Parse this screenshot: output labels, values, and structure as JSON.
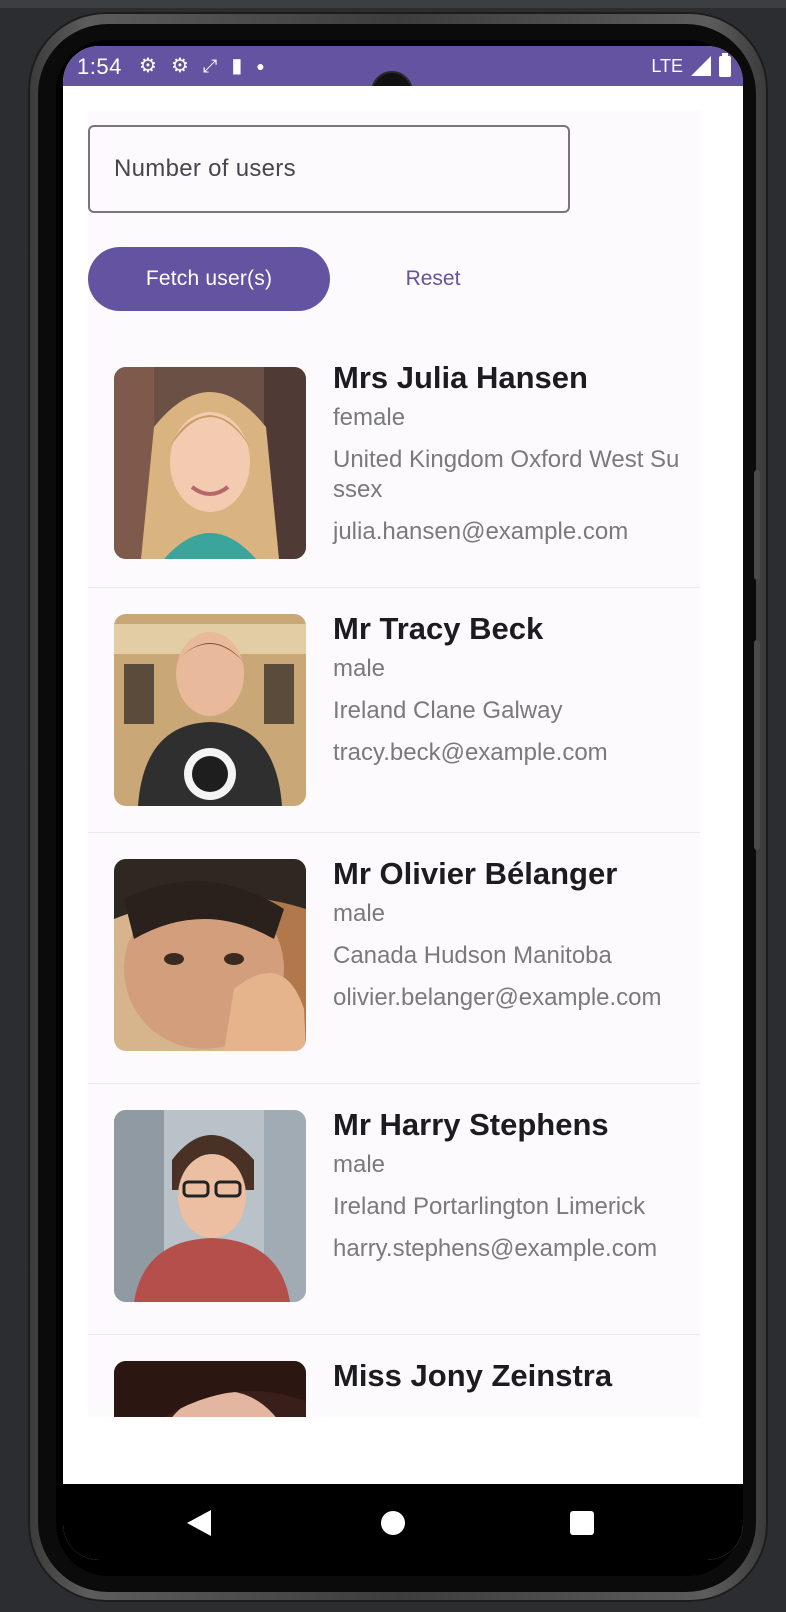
{
  "status_bar": {
    "time": "1:54",
    "network": "LTE",
    "icons": [
      "gear-icon",
      "gear-icon",
      "sync-icon",
      "sd-card-icon",
      "dot-icon",
      "signal-icon",
      "battery-icon"
    ]
  },
  "form": {
    "number_of_users_label": "Number of users",
    "fetch_button": "Fetch user(s)",
    "reset_button": "Reset"
  },
  "users": [
    {
      "name": "Mrs Julia Hansen",
      "gender": "female",
      "location": "United Kingdom Oxford West Sussex",
      "email": "julia.hansen@example.com"
    },
    {
      "name": "Mr Tracy Beck",
      "gender": "male",
      "location": "Ireland Clane Galway",
      "email": "tracy.beck@example.com"
    },
    {
      "name": "Mr Olivier Bélanger",
      "gender": "male",
      "location": "Canada Hudson Manitoba",
      "email": "olivier.belanger@example.com"
    },
    {
      "name": "Mr Harry Stephens",
      "gender": "male",
      "location": "Ireland Portarlington Limerick",
      "email": "harry.stephens@example.com"
    },
    {
      "name": "Miss Jony Zeinstra"
    }
  ],
  "colors": {
    "primary": "#6353a0",
    "outline": "#79747e",
    "surface": "#fcfafd",
    "secondary_text": "#7a7a7a"
  }
}
